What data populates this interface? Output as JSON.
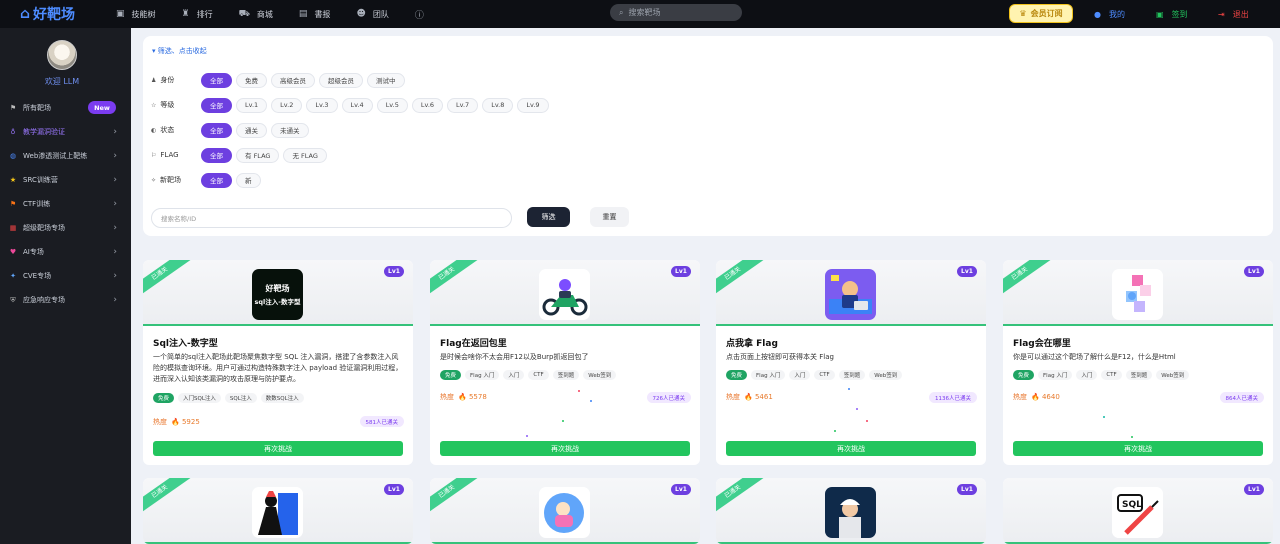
{
  "topbar": {
    "logo": "好靶场",
    "nav": [
      {
        "label": "技能树",
        "icon": "house-icon"
      },
      {
        "label": "排行",
        "icon": "trophy-icon"
      },
      {
        "label": "商城",
        "icon": "cart-icon"
      },
      {
        "label": "書报",
        "icon": "document-icon"
      },
      {
        "label": "团队",
        "icon": "team-icon"
      }
    ],
    "search_placeholder": "搜索靶场",
    "vip_label": "会员订阅",
    "me_label": "我的",
    "checkin_label": "签到",
    "logout_label": "退出",
    "colors": {
      "accent": "#6d3fe0",
      "brand": "#4d8cff",
      "green": "#22c55e"
    }
  },
  "sidebar": {
    "welcome": "欢迎 LLM",
    "items": [
      {
        "label": "所有靶场",
        "icon": "flag-icon",
        "badge": "New"
      },
      {
        "label": "教学漏洞验证",
        "icon": "bulb-icon",
        "active": true
      },
      {
        "label": "Web渗透测试上靶练",
        "icon": "globe-icon"
      },
      {
        "label": "SRC训练营",
        "icon": "star-icon"
      },
      {
        "label": "CTF训练",
        "icon": "flag-icon"
      },
      {
        "label": "超级靶场专场",
        "icon": "grid-icon"
      },
      {
        "label": "AI专场",
        "icon": "heart-icon"
      },
      {
        "label": "CVE专场",
        "icon": "bug-icon"
      },
      {
        "label": "应急响应专场",
        "icon": "shield-icon"
      }
    ]
  },
  "filter": {
    "header": "筛选、点击收起",
    "rows": [
      {
        "label": "身份",
        "options": [
          "全部",
          "免费",
          "高级会员",
          "超级会员",
          "测试中"
        ]
      },
      {
        "label": "等级",
        "options": [
          "全部",
          "Lv.1",
          "Lv.2",
          "Lv.3",
          "Lv.4",
          "Lv.5",
          "Lv.6",
          "Lv.7",
          "Lv.8",
          "Lv.9"
        ]
      },
      {
        "label": "状态",
        "options": [
          "全部",
          "通关",
          "未通关"
        ]
      },
      {
        "label": "FLAG",
        "options": [
          "全部",
          "有 FLAG",
          "无 FLAG"
        ]
      },
      {
        "label": "新靶场",
        "options": [
          "全部",
          "新"
        ]
      }
    ],
    "keyword_placeholder": "搜索名称/ID",
    "search_button": "筛选",
    "reset_button": "重置"
  },
  "cards": [
    {
      "ribbon": "已通关",
      "level": "Lv1",
      "title": "Sql注入-数字型",
      "desc": "一个简单的sql注入靶场此靶场聚焦数字型 SQL 注入漏洞，搭建了含参数注入风险的模拟查询环境。用户可通过构造特殊数字注入 payload 验证漏洞利用过程，进而深入认知该类漏洞的攻击原理与防护要点。",
      "tags": [
        "免费",
        "入门SQL注入",
        "SQL注入",
        "数数SQL注入"
      ],
      "heat_label": "热度",
      "heat": "5925",
      "passed": "581人已通关",
      "button": "再次挑战",
      "thumb_title": "好靶场",
      "thumb_sub": "sql注入-数字型"
    },
    {
      "ribbon": "已通关",
      "level": "Lv1",
      "title": "Flag在返回包里",
      "desc": "是时候会啥你不太会用F12以及Burp抓返回包了",
      "tags": [
        "免费",
        "Flag 入门",
        "入门",
        "CTF",
        "签到题",
        "Web签到"
      ],
      "heat_label": "热度",
      "heat": "5578",
      "passed": "726人已通关",
      "button": "再次挑战"
    },
    {
      "ribbon": "已通关",
      "level": "Lv1",
      "title": "点我拿 Flag",
      "desc": "点击页面上按钮即可获得本关 Flag",
      "tags": [
        "免费",
        "Flag 入门",
        "入门",
        "CTF",
        "签到题",
        "Web签到"
      ],
      "heat_label": "热度",
      "heat": "5461",
      "passed": "1136人已通关",
      "button": "再次挑战"
    },
    {
      "ribbon": "已通关",
      "level": "Lv1",
      "title": "Flag会在哪里",
      "desc": "你是可以通过这个靶场了解什么是F12，什么是Html",
      "tags": [
        "免费",
        "Flag 入门",
        "入门",
        "CTF",
        "签到题",
        "Web签到"
      ],
      "heat_label": "热度",
      "heat": "4640",
      "passed": "864人已通关",
      "button": "再次挑战"
    },
    {
      "ribbon": "已通关",
      "level": "Lv1"
    },
    {
      "ribbon": "已通关",
      "level": "Lv1"
    },
    {
      "ribbon": "已通关",
      "level": "Lv1"
    },
    {
      "ribbon": "",
      "level": "Lv1",
      "thumb_title": "SQL"
    }
  ]
}
